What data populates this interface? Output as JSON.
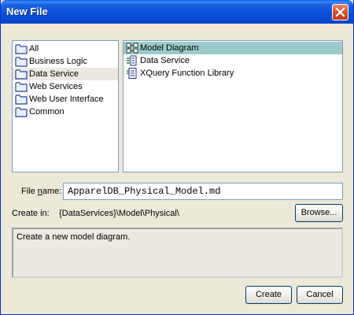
{
  "window": {
    "title": "New File"
  },
  "folders": [
    {
      "label": "All",
      "selected": false
    },
    {
      "label": "Business Logic",
      "selected": false
    },
    {
      "label": "Data Service",
      "selected": true
    },
    {
      "label": "Web Services",
      "selected": false
    },
    {
      "label": "Web User Interface",
      "selected": false
    },
    {
      "label": "Common",
      "selected": false
    }
  ],
  "templates": [
    {
      "label": "Model Diagram",
      "icon": "model-diagram-icon",
      "selected": true
    },
    {
      "label": "Data Service",
      "icon": "data-service-icon",
      "selected": false
    },
    {
      "label": "XQuery Function Library",
      "icon": "xquery-library-icon",
      "selected": false
    }
  ],
  "file_name": {
    "label_prefix": "File ",
    "label_mnemonic": "n",
    "label_suffix": "ame:",
    "value": "ApparelDB_Physical_Model.md"
  },
  "create_in": {
    "label": "Create in:",
    "value": "{DataServices}\\Model\\Physical\\",
    "browse_label": "Browse..."
  },
  "description": "Create a new model diagram.",
  "buttons": {
    "create": "Create",
    "cancel": "Cancel"
  },
  "colors": {
    "title_bar": "#0a4fd6",
    "selected_template": "#9acbcb",
    "dialog_bg": "#ece9d8"
  }
}
